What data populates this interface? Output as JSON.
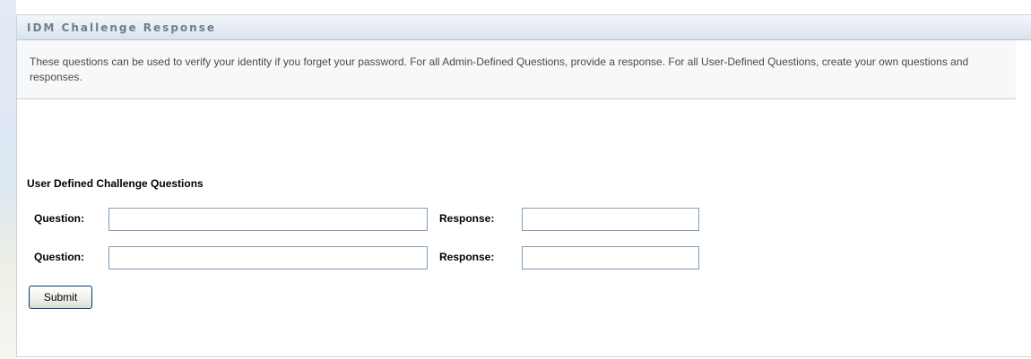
{
  "panel": {
    "title": "IDM Challenge Response",
    "intro_text": "These questions can be used to verify your identity if you forget your password. For all Admin-Defined Questions, provide a response. For all User-Defined Questions, create your own questions and responses."
  },
  "user_defined": {
    "section_title": "User Defined Challenge Questions",
    "rows": [
      {
        "question_label": "Question:",
        "question_value": "",
        "response_label": "Response:",
        "response_value": ""
      },
      {
        "question_label": "Question:",
        "question_value": "",
        "response_label": "Response:",
        "response_value": ""
      }
    ]
  },
  "actions": {
    "submit_label": "Submit"
  },
  "colors": {
    "header_text": "#6f7d8e",
    "border": "#c9d3df",
    "input_border": "#7f9db9",
    "button_border": "#003c74"
  }
}
